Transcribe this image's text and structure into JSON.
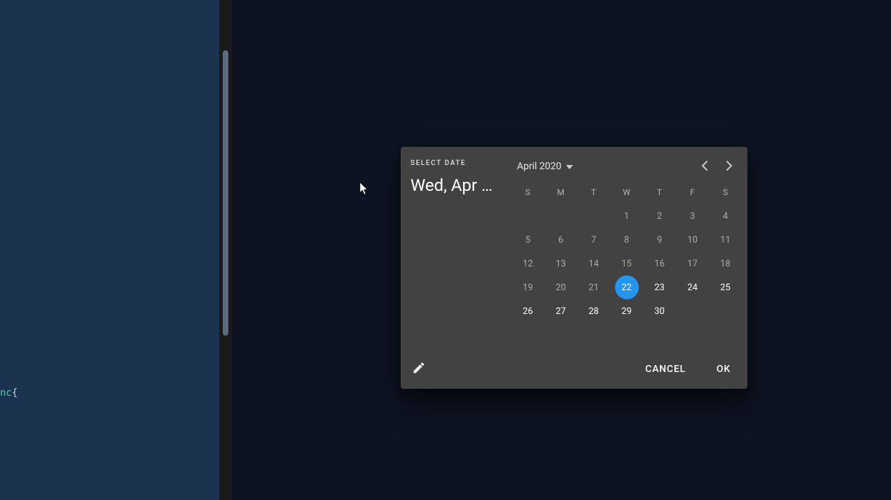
{
  "sidebar": {
    "code_keyword": "nc",
    "code_brace": "{"
  },
  "datepicker": {
    "select_label": "SELECT DATE",
    "selected_display": "Wed, Apr …",
    "month_label": "April 2020",
    "weekdays": [
      "S",
      "M",
      "T",
      "W",
      "T",
      "F",
      "S"
    ],
    "selected_day": 22,
    "today_day": 22,
    "days": [
      {
        "n": null
      },
      {
        "n": null
      },
      {
        "n": null
      },
      {
        "n": 1
      },
      {
        "n": 2
      },
      {
        "n": 3
      },
      {
        "n": 4
      },
      {
        "n": 5
      },
      {
        "n": 6
      },
      {
        "n": 7
      },
      {
        "n": 8
      },
      {
        "n": 9
      },
      {
        "n": 10
      },
      {
        "n": 11
      },
      {
        "n": 12
      },
      {
        "n": 13
      },
      {
        "n": 14
      },
      {
        "n": 15
      },
      {
        "n": 16
      },
      {
        "n": 17
      },
      {
        "n": 18
      },
      {
        "n": 19
      },
      {
        "n": 20
      },
      {
        "n": 21
      },
      {
        "n": 22
      },
      {
        "n": 23
      },
      {
        "n": 24
      },
      {
        "n": 25
      },
      {
        "n": 26
      },
      {
        "n": 27
      },
      {
        "n": 28
      },
      {
        "n": 29
      },
      {
        "n": 30
      },
      {
        "n": null
      },
      {
        "n": null
      }
    ],
    "actions": {
      "cancel": "CANCEL",
      "ok": "OK"
    }
  },
  "colors": {
    "accent": "#2196f3",
    "dialog_bg": "#424242",
    "sidebar_bg": "#1c3350",
    "app_bg": "#0d1321"
  }
}
